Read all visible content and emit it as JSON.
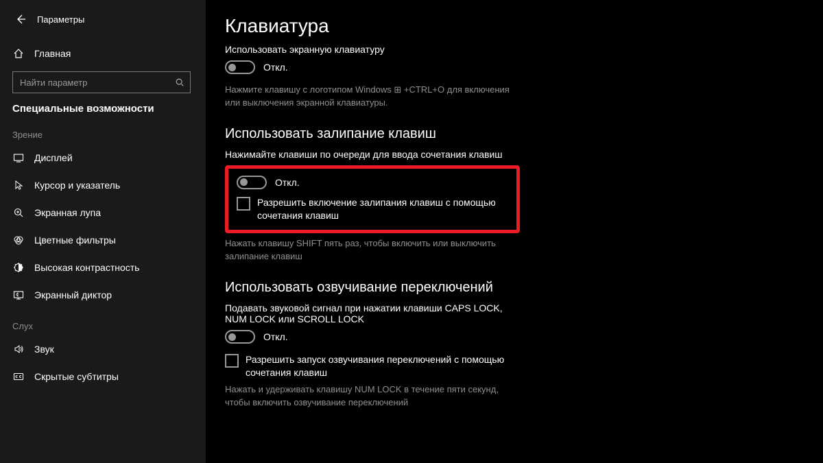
{
  "header": {
    "app_title": "Параметры"
  },
  "sidebar": {
    "home_label": "Главная",
    "search_placeholder": "Найти параметр",
    "category_label": "Специальные возможности",
    "group_vision_label": "Зрение",
    "items_vision": [
      {
        "label": "Дисплей"
      },
      {
        "label": "Курсор и указатель"
      },
      {
        "label": "Экранная лупа"
      },
      {
        "label": "Цветные фильтры"
      },
      {
        "label": "Высокая контрастность"
      },
      {
        "label": "Экранный диктор"
      }
    ],
    "group_hearing_label": "Слух",
    "items_hearing": [
      {
        "label": "Звук"
      },
      {
        "label": "Скрытые субтитры"
      }
    ]
  },
  "main": {
    "title": "Клавиатура",
    "osk": {
      "heading": "Использовать экранную клавиатуру",
      "toggle_state": "Откл.",
      "hint": "Нажмите клавишу с логотипом Windows ⊞ +CTRL+O для включения или выключения экранной клавиатуры."
    },
    "sticky": {
      "heading": "Использовать залипание клавиш",
      "desc": "Нажимайте клавиши по очереди для ввода сочетания клавиш",
      "toggle_state": "Откл.",
      "checkbox_label": "Разрешить включение залипания клавиш с помощью сочетания клавиш",
      "hint": "Нажать клавишу SHIFT пять раз, чтобы включить или выключить залипание клавиш"
    },
    "togglekeys": {
      "heading": "Использовать озвучивание переключений",
      "desc": "Подавать звуковой сигнал при нажатии клавиши CAPS LOCK, NUM LOCK или SCROLL LOCK",
      "toggle_state": "Откл.",
      "checkbox_label": "Разрешить запуск озвучивания переключений с помощью сочетания клавиш",
      "hint": "Нажать и удерживать клавишу NUM LOCK в течение пяти секунд, чтобы включить озвучивание переключений"
    }
  }
}
